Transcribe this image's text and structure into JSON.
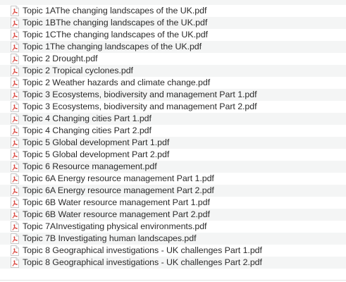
{
  "file_list": {
    "icon": "pdf-file-icon",
    "icon_color": "#d9433b",
    "files": [
      {
        "name": "Topic 1AThe changing landscapes of the UK.pdf"
      },
      {
        "name": "Topic 1BThe changing landscapes of the UK.pdf"
      },
      {
        "name": "Topic 1CThe changing landscapes of the UK.pdf"
      },
      {
        "name": "Topic 1The changing landscapes of the UK.pdf"
      },
      {
        "name": "Topic 2 Drought.pdf"
      },
      {
        "name": "Topic 2 Tropical cyclones.pdf"
      },
      {
        "name": "Topic 2 Weather hazards and climate change.pdf"
      },
      {
        "name": "Topic 3 Ecosystems, biodiversity and management Part 1.pdf"
      },
      {
        "name": "Topic 3 Ecosystems, biodiversity and management Part 2.pdf"
      },
      {
        "name": "Topic 4 Changing cities Part 1.pdf"
      },
      {
        "name": "Topic 4 Changing cities Part 2.pdf"
      },
      {
        "name": "Topic 5 Global development Part 1.pdf"
      },
      {
        "name": "Topic 5 Global development Part 2.pdf"
      },
      {
        "name": "Topic 6 Resource management.pdf"
      },
      {
        "name": "Topic 6A Energy resource management Part 1.pdf"
      },
      {
        "name": "Topic 6A Energy resource management Part 2.pdf"
      },
      {
        "name": "Topic 6B Water resource management Part 1.pdf"
      },
      {
        "name": "Topic 6B Water resource management Part 2.pdf"
      },
      {
        "name": "Topic 7AInvestigating physical environments.pdf"
      },
      {
        "name": "Topic 7B Investigating human landscapes.pdf"
      },
      {
        "name": "Topic 8 Geographical investigations - UK challenges Part 1.pdf"
      },
      {
        "name": "Topic 8 Geographical investigations - UK challenges Part 2.pdf"
      }
    ]
  }
}
